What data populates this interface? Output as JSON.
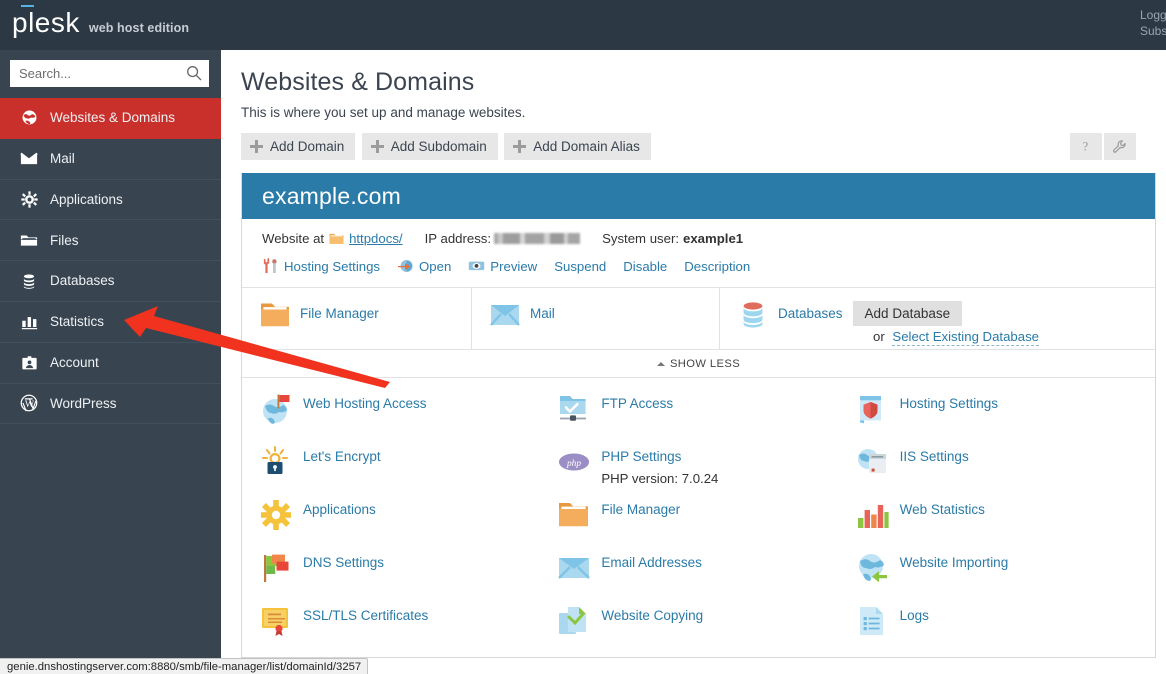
{
  "topbar": {
    "logo_text": "plesk",
    "logo_edition": "web host edition",
    "right_links": [
      "Logg",
      "Subs"
    ]
  },
  "search": {
    "placeholder": "Search...",
    "value": "",
    "icon": "search-icon"
  },
  "sidebar": {
    "items": [
      {
        "label": "Websites & Domains",
        "icon": "globe-icon",
        "active": true
      },
      {
        "label": "Mail",
        "icon": "envelope-icon",
        "active": false
      },
      {
        "label": "Applications",
        "icon": "gear-icon",
        "active": false
      },
      {
        "label": "Files",
        "icon": "folder-icon",
        "active": false
      },
      {
        "label": "Databases",
        "icon": "database-icon",
        "active": false
      },
      {
        "label": "Statistics",
        "icon": "bar-chart-icon",
        "active": false
      },
      {
        "label": "Account",
        "icon": "id-card-icon",
        "active": false
      },
      {
        "label": "WordPress",
        "icon": "wordpress-icon",
        "active": false
      }
    ]
  },
  "page": {
    "title": "Websites & Domains",
    "subtitle": "This is where you set up and manage websites."
  },
  "toolbar": {
    "buttons": [
      {
        "label": "Add Domain",
        "icon": "plus-icon"
      },
      {
        "label": "Add Subdomain",
        "icon": "plus-icon"
      },
      {
        "label": "Add Domain Alias",
        "icon": "plus-icon"
      }
    ],
    "help_label": "?",
    "help_icon": "question-mark-icon",
    "tools_icon": "wrench-icon"
  },
  "domain_panel": {
    "name": "example.com",
    "website_at_label": "Website at",
    "webroot": "httpdocs/",
    "ip_label": "IP address:",
    "ip_value": "",
    "system_user_label": "System user:",
    "system_user": "example1",
    "actions": [
      {
        "label": "Hosting Settings",
        "icon": "tools-icon"
      },
      {
        "label": "Open",
        "icon": "open-arrow-icon"
      },
      {
        "label": "Preview",
        "icon": "eye-icon"
      },
      {
        "label": "Suspend",
        "icon": ""
      },
      {
        "label": "Disable",
        "icon": ""
      },
      {
        "label": "Description",
        "icon": ""
      }
    ],
    "services": [
      {
        "label": "File Manager",
        "icon": "folder-icon"
      },
      {
        "label": "Mail",
        "icon": "envelope-icon"
      },
      {
        "label": "Databases",
        "icon": "database-icon"
      }
    ],
    "add_database_button": "Add Database",
    "or_label": "or",
    "select_existing_database": "Select Existing Database",
    "show_less_label": "SHOW LESS",
    "show_less_icon": "chevron-up-icon"
  },
  "link_grid": {
    "columns": [
      {
        "items": [
          {
            "label": "Web Hosting Access",
            "icon": "globe-flag-icon",
            "note": ""
          },
          {
            "label": "Let's Encrypt",
            "icon": "lets-encrypt-icon",
            "note": ""
          },
          {
            "label": "Applications",
            "icon": "gear-icon",
            "note": ""
          },
          {
            "label": "DNS Settings",
            "icon": "dns-flags-icon",
            "note": ""
          },
          {
            "label": "SSL/TLS Certificates",
            "icon": "certificate-icon",
            "note": ""
          }
        ]
      },
      {
        "items": [
          {
            "label": "FTP Access",
            "icon": "ftp-folder-icon",
            "note": ""
          },
          {
            "label": "PHP Settings",
            "icon": "php-icon",
            "note": "PHP version: 7.0.24"
          },
          {
            "label": "File Manager",
            "icon": "folder-icon",
            "note": ""
          },
          {
            "label": "Email Addresses",
            "icon": "envelope-icon",
            "note": ""
          },
          {
            "label": "Website Copying",
            "icon": "copy-pages-icon",
            "note": ""
          }
        ]
      },
      {
        "items": [
          {
            "label": "Hosting Settings",
            "icon": "shield-box-icon",
            "note": ""
          },
          {
            "label": "IIS Settings",
            "icon": "iis-server-icon",
            "note": ""
          },
          {
            "label": "Web Statistics",
            "icon": "bar-chart-icon",
            "note": ""
          },
          {
            "label": "Website Importing",
            "icon": "globe-import-icon",
            "note": ""
          },
          {
            "label": "Logs",
            "icon": "document-lines-icon",
            "note": ""
          }
        ]
      }
    ]
  },
  "annotation": {
    "type": "arrow",
    "color": "#f0321e",
    "points_to": "sidebar-item-statistics"
  },
  "statusbar": {
    "url": "genie.dnshostingserver.com:8880/smb/file-manager/list/domainId/3257"
  },
  "colors": {
    "topbar_bg": "#2d3845",
    "sidebar_bg": "#384450",
    "sidebar_active": "#c9302c",
    "panel_header": "#2a7ba8",
    "link_blue": "#2a7ba8",
    "annotation_red": "#f0321e"
  }
}
